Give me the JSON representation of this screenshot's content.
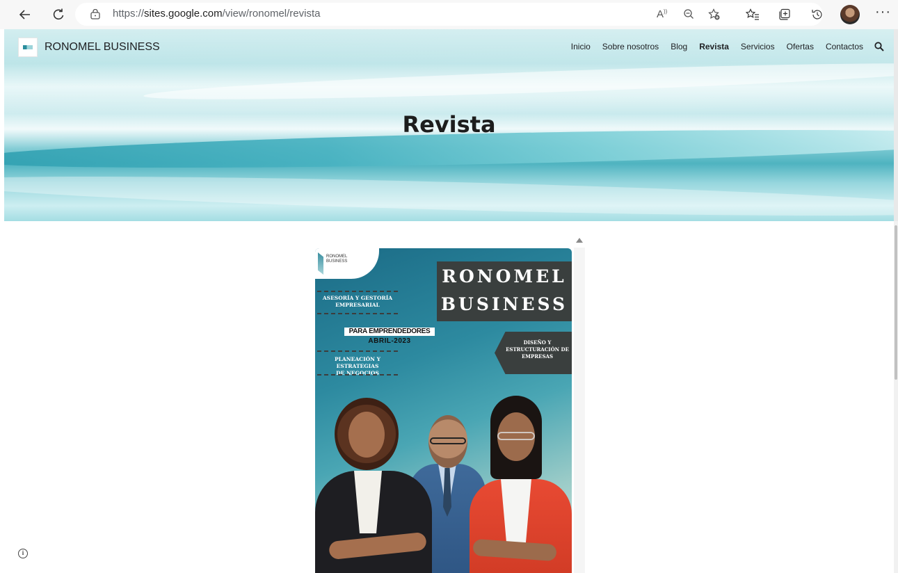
{
  "browser": {
    "url_prefix": "https://",
    "url_host": "sites.google.com",
    "url_path": "/view/ronomel/revista",
    "icons": [
      "back-arrow-icon",
      "reload-icon",
      "lock-icon",
      "read-aloud-icon",
      "zoom-out-icon",
      "add-favorite-icon",
      "favorites-icon",
      "collections-icon",
      "history-icon",
      "profile-avatar",
      "more-icon"
    ]
  },
  "site": {
    "name": "RONOMEL BUSINESS",
    "nav": [
      "Inicio",
      "Sobre nosotros",
      "Blog",
      "Revista",
      "Servicios",
      "Ofertas",
      "Contactos"
    ],
    "active_nav": "Revista",
    "page_title": "Revista"
  },
  "magazine": {
    "logo_line1": "RONOMEL",
    "logo_line2": "BUSINESS",
    "title_line1": "RONOMEL",
    "title_line2": "BUSINESS",
    "tagline1_line1": "ASESORÍA Y GESTORÍA",
    "tagline1_line2": "EMPRESARIAL",
    "audience": "PARA EMPRENDEDORES",
    "date": "ABRIL-2023",
    "tagline2_line1": "PLANEACIÓN Y ESTRATEGIAS",
    "tagline2_line2": "DE NEGOCIOS",
    "arrow_line1": "DISEÑO Y",
    "arrow_line2": "ESTRUCTURACIÓN DE",
    "arrow_line3": "EMPRESAS"
  },
  "colors": {
    "cover_dark": "#3a3f3e",
    "cover_teal": "#2d8aa0",
    "hero_teal": "#4fb3c0"
  }
}
